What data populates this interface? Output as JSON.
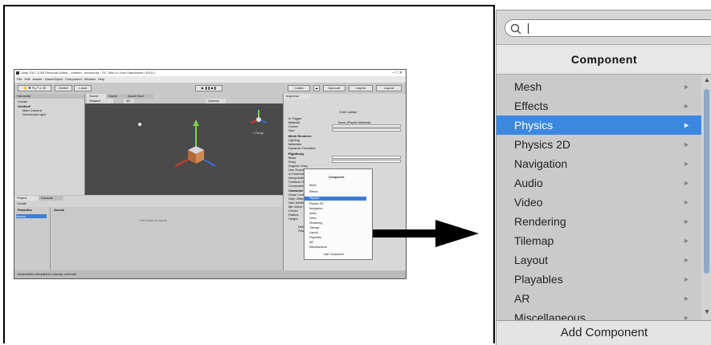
{
  "unity_window": {
    "title": "Unity 2017.3.0f3 Personal (64bit) - Untitled - demounity - PC, Mac & Linux Standalone <DX11>",
    "menu": "File  Edit  Assets  GameObject  Component  Window  Help",
    "toolbar": {
      "center": "Center",
      "local": "Local",
      "collab": "Collab",
      "account": "Account",
      "layers": "Layers",
      "layout": "Layout"
    },
    "hierarchy": {
      "tab": "Hierarchy",
      "create": "Create",
      "scene": "Untitled*",
      "items": [
        "Main Camera",
        "Directional Light"
      ]
    },
    "scene_tabs": [
      "Scene",
      "Game",
      "Asset Store"
    ],
    "scene_toolbar": {
      "shaded": "Shaded",
      "mode2d": "2D",
      "gizmos": "Gizmos"
    },
    "persp": "< Persp",
    "project": {
      "tabs": [
        "Project",
        "Console"
      ],
      "create": "Create",
      "favorites": "Favorites",
      "assets": "Assets",
      "sidebar_assets": "Assets",
      "empty_text": "This folder is empty"
    },
    "inspector": {
      "tab": "Inspector",
      "edit_collider": "Edit Collider",
      "rows": [
        "Is Trigger",
        "Material",
        "Center",
        "Size",
        "Mesh Renderer",
        "Lighting",
        "Materials",
        "Dynamic Occluded",
        "Rigidbody",
        "Mass",
        "Drag",
        "Angular Drag",
        "Use Gravity",
        "Is Kinematic",
        "Interpolate",
        "Collision Detect",
        "Constraints",
        "Character",
        "Slope Limit",
        "Step Offset",
        "Skin Width",
        "Min Move Dista",
        "Center",
        "Radius",
        "Height"
      ],
      "material_value": "None (Physic Material)",
      "default_material": "Default",
      "shader": "Shader",
      "add_component": "Add Component"
    },
    "popup": {
      "title": "Component",
      "items": [
        "Mesh",
        "Effects",
        "Physics",
        "Physics 2D",
        "Navigation",
        "Audio",
        "Video",
        "Rendering",
        "Tilemap",
        "Layout",
        "Playables",
        "AR",
        "Miscellaneous"
      ],
      "selected_index": 2,
      "add_button": "Add Component"
    },
    "status": "Assemblies reloaded for startup out-fresh"
  },
  "component_menu": {
    "search": {
      "value": "",
      "icon": "search-icon"
    },
    "header": "Component",
    "items": [
      {
        "label": "Mesh",
        "selected": false
      },
      {
        "label": "Effects",
        "selected": false
      },
      {
        "label": "Physics",
        "selected": true
      },
      {
        "label": "Physics 2D",
        "selected": false
      },
      {
        "label": "Navigation",
        "selected": false
      },
      {
        "label": "Audio",
        "selected": false
      },
      {
        "label": "Video",
        "selected": false
      },
      {
        "label": "Rendering",
        "selected": false
      },
      {
        "label": "Tilemap",
        "selected": false
      },
      {
        "label": "Layout",
        "selected": false
      },
      {
        "label": "Playables",
        "selected": false
      },
      {
        "label": "AR",
        "selected": false
      },
      {
        "label": "Miscellaneous",
        "selected": false
      }
    ],
    "chevron": "►",
    "add_component": "Add Component",
    "colors": {
      "selected": "#3c88e0",
      "background": "#c9c9c9",
      "header": "#e7e7e7"
    }
  },
  "arrow": {
    "icon": "right-arrow-icon",
    "color": "#000000"
  }
}
